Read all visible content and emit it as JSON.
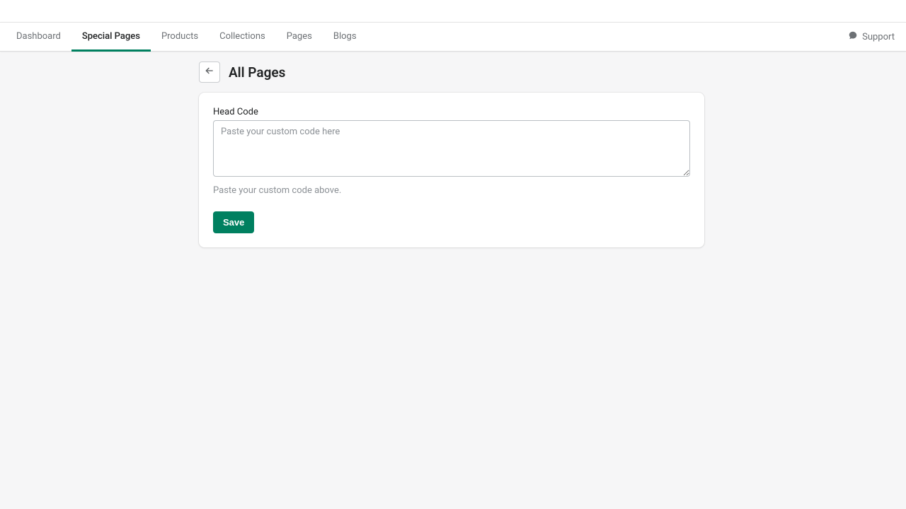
{
  "nav": {
    "tabs": [
      {
        "label": "Dashboard"
      },
      {
        "label": "Special Pages"
      },
      {
        "label": "Products"
      },
      {
        "label": "Collections"
      },
      {
        "label": "Pages"
      },
      {
        "label": "Blogs"
      }
    ],
    "support_label": "Support"
  },
  "page": {
    "title": "All Pages",
    "field_label": "Head Code",
    "placeholder": "Paste your custom code here",
    "help_text": "Paste your custom code above.",
    "save_label": "Save"
  }
}
